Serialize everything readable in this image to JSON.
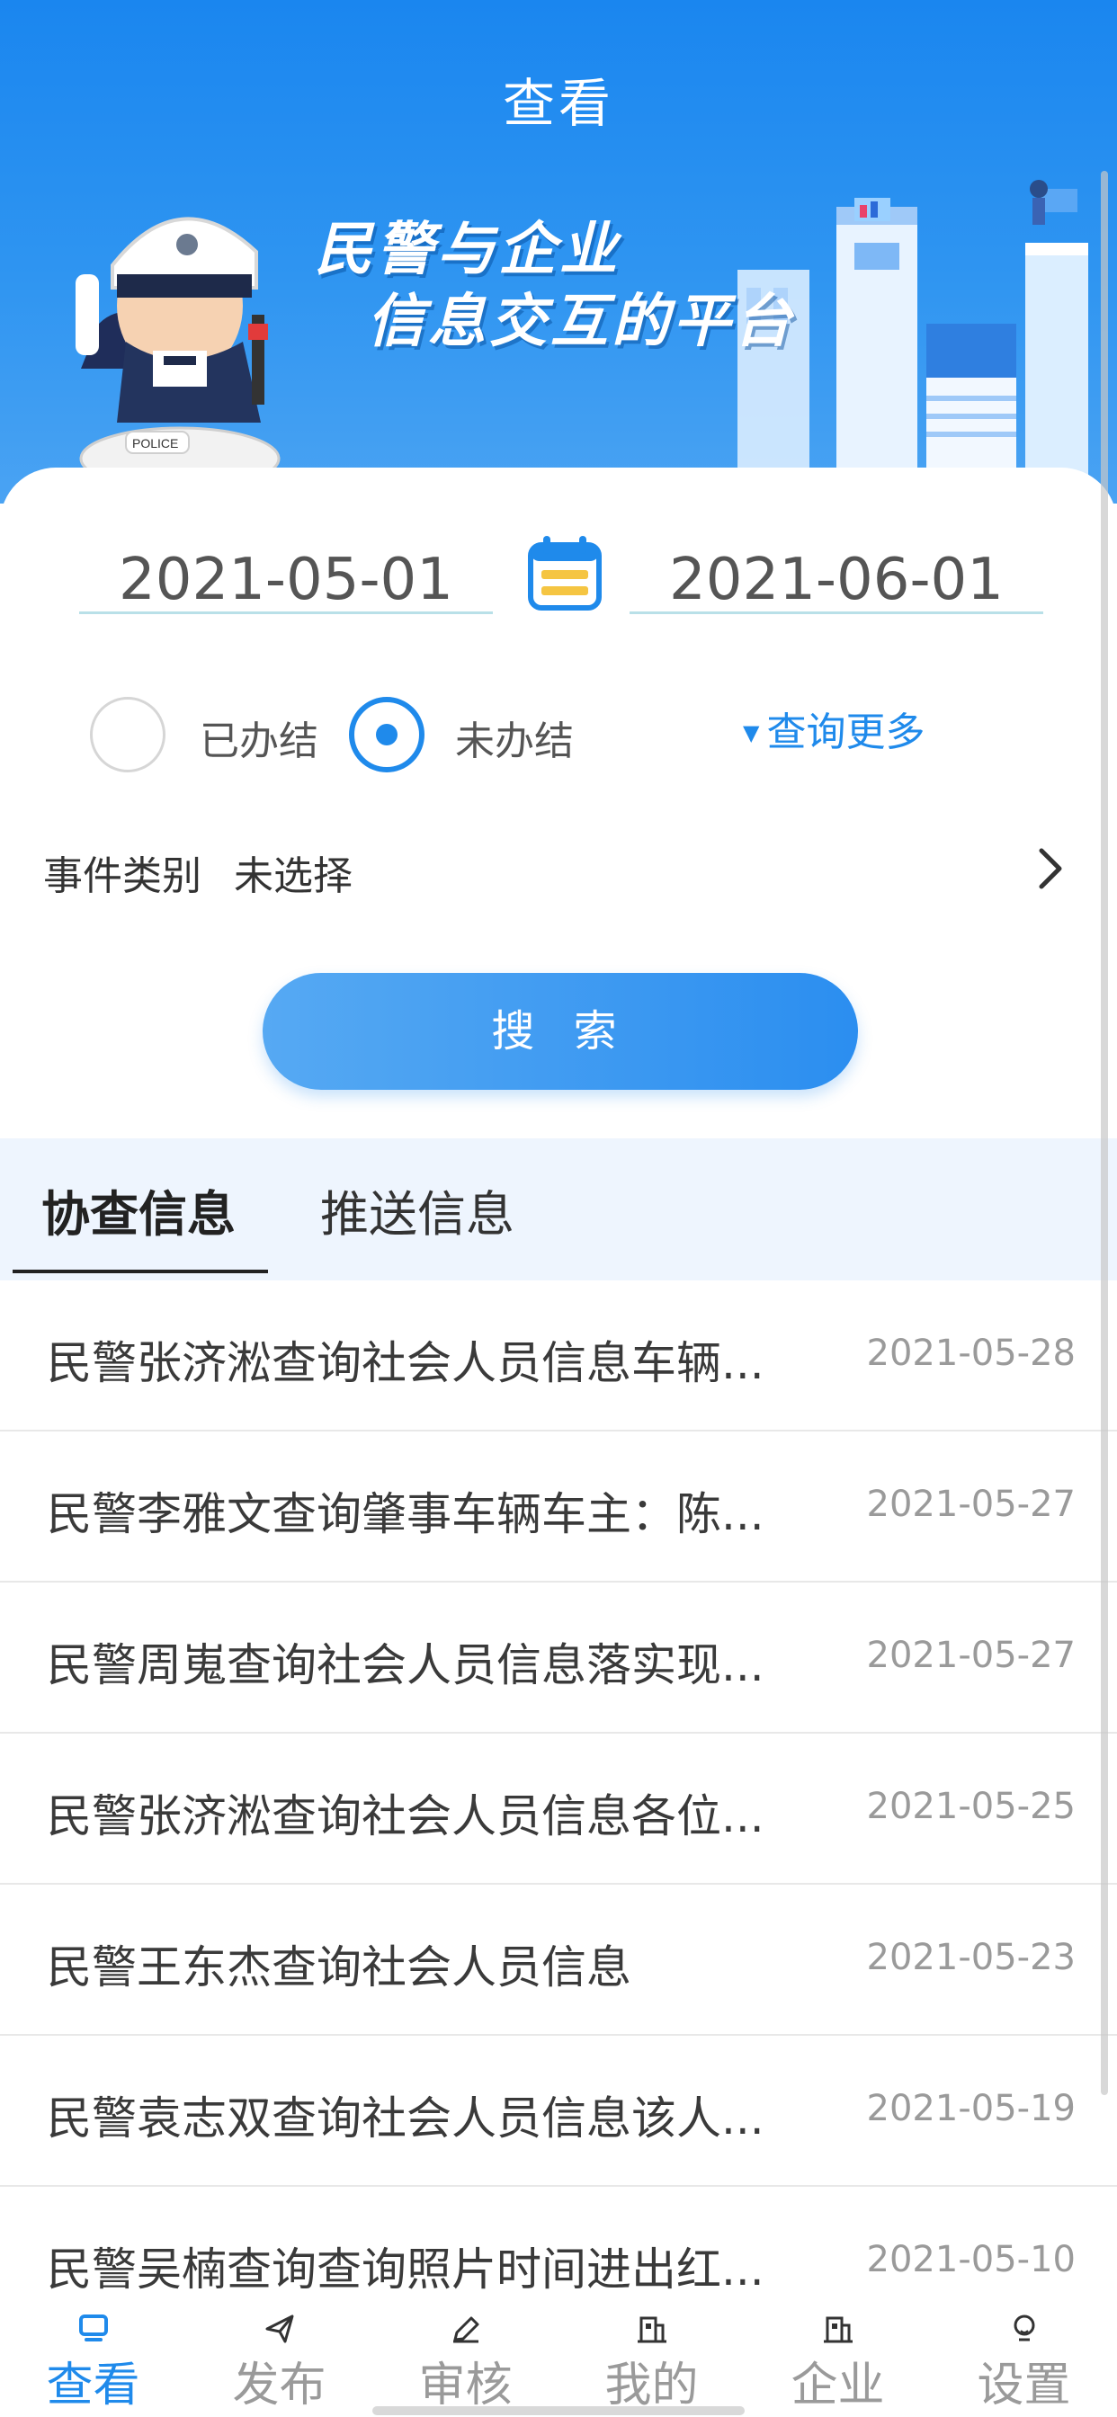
{
  "header": {
    "title": "查看"
  },
  "banner": {
    "slogan_line1": "民警与企业",
    "slogan_line2": "信息交互的平台",
    "badge": "POLICE"
  },
  "search": {
    "start_date": "2021-05-01",
    "end_date": "2021-06-01",
    "status_done": "已办结",
    "status_pending": "未办结",
    "selected_status": "未办结",
    "query_more": "查询更多",
    "category_label": "事件类别",
    "category_value": "未选择",
    "search_button": "搜 索"
  },
  "tabs": [
    {
      "label": "协查信息",
      "active": true
    },
    {
      "label": "推送信息",
      "active": false
    }
  ],
  "list": [
    {
      "title": "民警张济淞查询社会人员信息车辆...",
      "date": "2021-05-28"
    },
    {
      "title": "民警李雅文查询肇事车辆车主：陈...",
      "date": "2021-05-27"
    },
    {
      "title": "民警周嵬查询社会人员信息落实现...",
      "date": "2021-05-27"
    },
    {
      "title": "民警张济淞查询社会人员信息各位...",
      "date": "2021-05-25"
    },
    {
      "title": "民警王东杰查询社会人员信息",
      "date": "2021-05-23"
    },
    {
      "title": "民警袁志双查询社会人员信息该人...",
      "date": "2021-05-19"
    },
    {
      "title": "民警吴楠查询查询照片时间进出红...",
      "date": "2021-05-10"
    }
  ],
  "bottom_nav": [
    {
      "label": "查看",
      "icon": "monitor-icon",
      "active": true
    },
    {
      "label": "发布",
      "icon": "send-icon",
      "active": false
    },
    {
      "label": "审核",
      "icon": "pen-icon",
      "active": false
    },
    {
      "label": "我的",
      "icon": "building-icon",
      "active": false
    },
    {
      "label": "企业",
      "icon": "building-icon",
      "active": false
    },
    {
      "label": "设置",
      "icon": "bulb-icon",
      "active": false
    }
  ],
  "colors": {
    "primary": "#1f8aeb",
    "tab_bg": "#eef5fe",
    "muted_text": "#9a9a9a"
  }
}
